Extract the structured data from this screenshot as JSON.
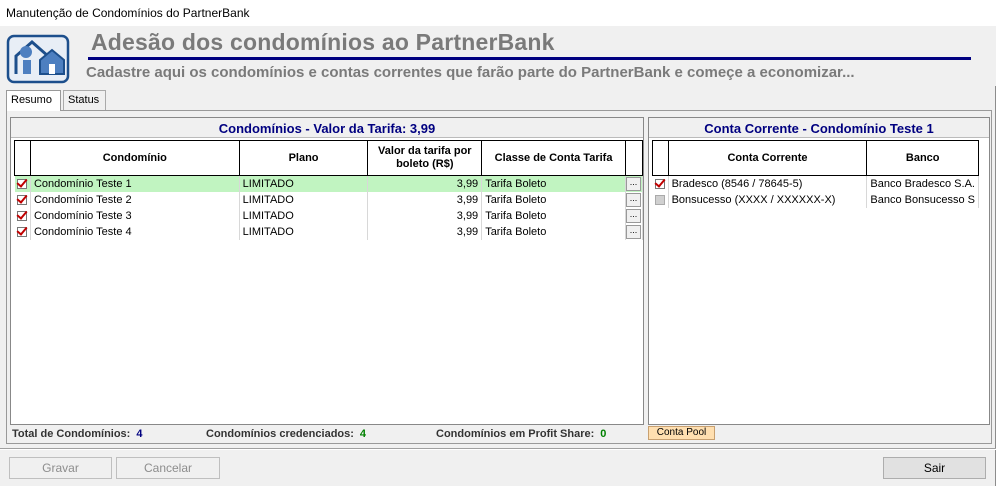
{
  "window": {
    "title": "Manutenção de Condomínios do PartnerBank"
  },
  "header": {
    "title": "Adesão dos condomínios ao PartnerBank",
    "subtitle": "Cadastre aqui os condomínios e contas correntes que farão parte do PartnerBank e começe a economizar...",
    "logo_icon": "houses-icon"
  },
  "tabs": [
    "Resumo",
    "Status"
  ],
  "condominios": {
    "title": "Condomínios - Valor da Tarifa: 3,99",
    "columns": [
      "Condomínio",
      "Plano",
      "Valor da tarifa por boleto (R$)",
      "Classe de Conta Tarifa"
    ],
    "rows": [
      {
        "checked": true,
        "nome": "Condomínio Teste 1",
        "plano": "LIMITADO",
        "valor": "3,99",
        "classe": "Tarifa Boleto",
        "selected": true
      },
      {
        "checked": true,
        "nome": "Condomínio Teste 2",
        "plano": "LIMITADO",
        "valor": "3,99",
        "classe": "Tarifa Boleto",
        "selected": false
      },
      {
        "checked": true,
        "nome": "Condomínio Teste 3",
        "plano": "LIMITADO",
        "valor": "3,99",
        "classe": "Tarifa Boleto",
        "selected": false
      },
      {
        "checked": true,
        "nome": "Condomínio Teste 4",
        "plano": "LIMITADO",
        "valor": "3,99",
        "classe": "Tarifa Boleto",
        "selected": false
      }
    ],
    "ellipsis": "..."
  },
  "contas": {
    "title": "Conta Corrente - Condomínio Teste 1",
    "columns": [
      "Conta Corrente",
      "Banco"
    ],
    "rows": [
      {
        "checked": true,
        "conta": "Bradesco (8546 / 78645-5)",
        "banco": "Banco Bradesco S.A."
      },
      {
        "checked": false,
        "conta": "Bonsucesso (XXXX / XXXXXX-X)",
        "banco": "Banco Bonsucesso S"
      }
    ]
  },
  "status_bar": {
    "total_label": "Total de Condomínios:",
    "total_value": "4",
    "cred_label": "Condomínios credenciados:",
    "cred_value": "4",
    "profit_label": "Condomínios em Profit Share:",
    "profit_value": "0",
    "pool_button": "Conta Pool"
  },
  "buttons": {
    "gravar": "Gravar",
    "cancelar": "Cancelar",
    "sair": "Sair"
  },
  "colors": {
    "title_blue": "#000080",
    "header_gray": "#7a7a7a",
    "selected_row": "#c1f4c1",
    "check_red": "#c00000",
    "pool_orange": "#ffdfb0"
  }
}
